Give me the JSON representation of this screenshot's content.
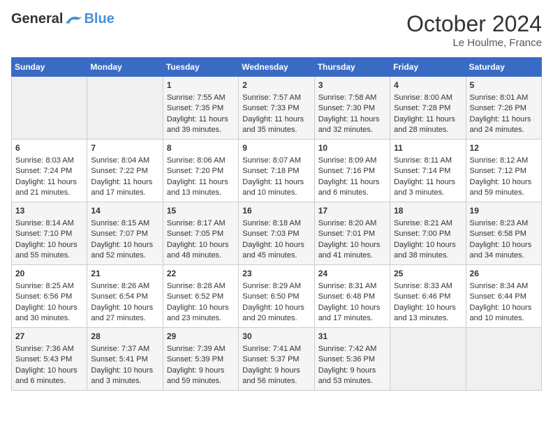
{
  "header": {
    "logo_general": "General",
    "logo_blue": "Blue",
    "month": "October 2024",
    "location": "Le Houlme, France"
  },
  "weekdays": [
    "Sunday",
    "Monday",
    "Tuesday",
    "Wednesday",
    "Thursday",
    "Friday",
    "Saturday"
  ],
  "weeks": [
    [
      {
        "day": "",
        "info": ""
      },
      {
        "day": "",
        "info": ""
      },
      {
        "day": "1",
        "info": "Sunrise: 7:55 AM\nSunset: 7:35 PM\nDaylight: 11 hours and 39 minutes."
      },
      {
        "day": "2",
        "info": "Sunrise: 7:57 AM\nSunset: 7:33 PM\nDaylight: 11 hours and 35 minutes."
      },
      {
        "day": "3",
        "info": "Sunrise: 7:58 AM\nSunset: 7:30 PM\nDaylight: 11 hours and 32 minutes."
      },
      {
        "day": "4",
        "info": "Sunrise: 8:00 AM\nSunset: 7:28 PM\nDaylight: 11 hours and 28 minutes."
      },
      {
        "day": "5",
        "info": "Sunrise: 8:01 AM\nSunset: 7:26 PM\nDaylight: 11 hours and 24 minutes."
      }
    ],
    [
      {
        "day": "6",
        "info": "Sunrise: 8:03 AM\nSunset: 7:24 PM\nDaylight: 11 hours and 21 minutes."
      },
      {
        "day": "7",
        "info": "Sunrise: 8:04 AM\nSunset: 7:22 PM\nDaylight: 11 hours and 17 minutes."
      },
      {
        "day": "8",
        "info": "Sunrise: 8:06 AM\nSunset: 7:20 PM\nDaylight: 11 hours and 13 minutes."
      },
      {
        "day": "9",
        "info": "Sunrise: 8:07 AM\nSunset: 7:18 PM\nDaylight: 11 hours and 10 minutes."
      },
      {
        "day": "10",
        "info": "Sunrise: 8:09 AM\nSunset: 7:16 PM\nDaylight: 11 hours and 6 minutes."
      },
      {
        "day": "11",
        "info": "Sunrise: 8:11 AM\nSunset: 7:14 PM\nDaylight: 11 hours and 3 minutes."
      },
      {
        "day": "12",
        "info": "Sunrise: 8:12 AM\nSunset: 7:12 PM\nDaylight: 10 hours and 59 minutes."
      }
    ],
    [
      {
        "day": "13",
        "info": "Sunrise: 8:14 AM\nSunset: 7:10 PM\nDaylight: 10 hours and 55 minutes."
      },
      {
        "day": "14",
        "info": "Sunrise: 8:15 AM\nSunset: 7:07 PM\nDaylight: 10 hours and 52 minutes."
      },
      {
        "day": "15",
        "info": "Sunrise: 8:17 AM\nSunset: 7:05 PM\nDaylight: 10 hours and 48 minutes."
      },
      {
        "day": "16",
        "info": "Sunrise: 8:18 AM\nSunset: 7:03 PM\nDaylight: 10 hours and 45 minutes."
      },
      {
        "day": "17",
        "info": "Sunrise: 8:20 AM\nSunset: 7:01 PM\nDaylight: 10 hours and 41 minutes."
      },
      {
        "day": "18",
        "info": "Sunrise: 8:21 AM\nSunset: 7:00 PM\nDaylight: 10 hours and 38 minutes."
      },
      {
        "day": "19",
        "info": "Sunrise: 8:23 AM\nSunset: 6:58 PM\nDaylight: 10 hours and 34 minutes."
      }
    ],
    [
      {
        "day": "20",
        "info": "Sunrise: 8:25 AM\nSunset: 6:56 PM\nDaylight: 10 hours and 30 minutes."
      },
      {
        "day": "21",
        "info": "Sunrise: 8:26 AM\nSunset: 6:54 PM\nDaylight: 10 hours and 27 minutes."
      },
      {
        "day": "22",
        "info": "Sunrise: 8:28 AM\nSunset: 6:52 PM\nDaylight: 10 hours and 23 minutes."
      },
      {
        "day": "23",
        "info": "Sunrise: 8:29 AM\nSunset: 6:50 PM\nDaylight: 10 hours and 20 minutes."
      },
      {
        "day": "24",
        "info": "Sunrise: 8:31 AM\nSunset: 6:48 PM\nDaylight: 10 hours and 17 minutes."
      },
      {
        "day": "25",
        "info": "Sunrise: 8:33 AM\nSunset: 6:46 PM\nDaylight: 10 hours and 13 minutes."
      },
      {
        "day": "26",
        "info": "Sunrise: 8:34 AM\nSunset: 6:44 PM\nDaylight: 10 hours and 10 minutes."
      }
    ],
    [
      {
        "day": "27",
        "info": "Sunrise: 7:36 AM\nSunset: 5:43 PM\nDaylight: 10 hours and 6 minutes."
      },
      {
        "day": "28",
        "info": "Sunrise: 7:37 AM\nSunset: 5:41 PM\nDaylight: 10 hours and 3 minutes."
      },
      {
        "day": "29",
        "info": "Sunrise: 7:39 AM\nSunset: 5:39 PM\nDaylight: 9 hours and 59 minutes."
      },
      {
        "day": "30",
        "info": "Sunrise: 7:41 AM\nSunset: 5:37 PM\nDaylight: 9 hours and 56 minutes."
      },
      {
        "day": "31",
        "info": "Sunrise: 7:42 AM\nSunset: 5:36 PM\nDaylight: 9 hours and 53 minutes."
      },
      {
        "day": "",
        "info": ""
      },
      {
        "day": "",
        "info": ""
      }
    ]
  ]
}
